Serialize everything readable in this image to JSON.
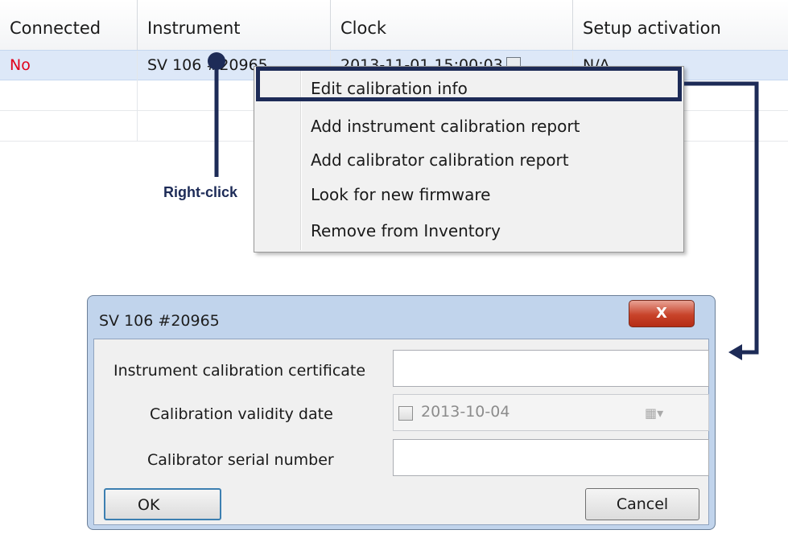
{
  "grid": {
    "columns": [
      "Connected",
      "Instrument",
      "Clock",
      "Setup activation"
    ],
    "rows": [
      {
        "connected": "No",
        "instrument": "SV 106 #20965",
        "clock": "2013-11-01 15:00:03",
        "setup": "N/A"
      }
    ],
    "colors": {
      "no": "#e0001b",
      "selected_row": "#dde8f8"
    }
  },
  "context_menu": {
    "items": [
      "Edit calibration info",
      "Add instrument calibration report",
      "Add calibrator calibration report",
      "Look for new firmware",
      "Remove from Inventory"
    ],
    "highlight_color": "#1d2b57"
  },
  "annotation": {
    "right_click_label": "Right-click"
  },
  "dialog": {
    "title": "SV 106 #20965",
    "close_glyph": "X",
    "fields": {
      "instrument_certificate_label": "Instrument calibration certificate",
      "instrument_certificate_value": "",
      "validity_date_label": "Calibration validity date",
      "validity_date_value": "2013-10-04",
      "validity_checked": false,
      "calibrator_serial_label": "Calibrator serial number",
      "calibrator_serial_value": ""
    },
    "ok_label": "OK",
    "cancel_label": "Cancel"
  }
}
